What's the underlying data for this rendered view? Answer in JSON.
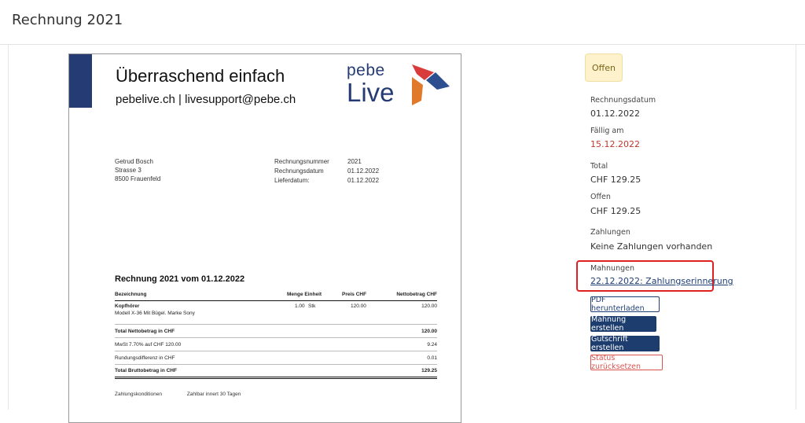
{
  "header": {
    "title": "Rechnung 2021"
  },
  "document": {
    "tagline": "Überraschend einfach",
    "contact": "pebelive.ch | livesupport@pebe.ch",
    "logo": {
      "line1": "pebe",
      "line2": "Live",
      "colors": {
        "navy": "#243c73",
        "red": "#d93a3a",
        "orange": "#e07a2a",
        "blue": "#2d4f8f"
      }
    },
    "customer": {
      "name": "Getrud Bosch",
      "street": "Strasse 3",
      "city": "8500 Frauenfeld"
    },
    "meta": [
      {
        "label": "Rechnungsnummer",
        "value": "2021"
      },
      {
        "label": "Rechnungsdatum",
        "value": "01.12.2022"
      },
      {
        "label": "Lieferdatum:",
        "value": "01.12.2022"
      }
    ],
    "invoice_title": "Rechnung 2021 vom 01.12.2022",
    "table": {
      "headers": {
        "desc": "Bezeichnung",
        "qty": "Menge Einheit",
        "price": "Preis CHF",
        "net": "Nettobetrag CHF"
      },
      "item": {
        "name": "Kopfhörer",
        "detail": "Modell X-36 Mit Bügel. Marke Sony",
        "qty": "1.00",
        "unit": "Stk",
        "price": "120.00",
        "net": "120.00"
      },
      "totals": [
        {
          "label": "Total Nettobetrag in CHF",
          "value": "120.00",
          "bold": true
        },
        {
          "label": "MwSt 7.70% auf CHF 120.00",
          "value": "9.24",
          "bold": false
        },
        {
          "label": "Rundungsdifferenz in CHF",
          "value": "0.01",
          "bold": false
        },
        {
          "label": "Total Bruttobetrag in CHF",
          "value": "129.25",
          "bold": true
        }
      ]
    },
    "terms": {
      "label": "Zahlungskonditionen",
      "value": "Zahlbar innert 30 Tagen"
    }
  },
  "panel": {
    "status": "Offen",
    "invoice_date_label": "Rechnungsdatum",
    "invoice_date": "01.12.2022",
    "due_label": "Fällig am",
    "due_date": "15.12.2022",
    "total_label": "Total",
    "total": "CHF 129.25",
    "open_label": "Offen",
    "open": "CHF 129.25",
    "payments_label": "Zahlungen",
    "payments": "Keine Zahlungen vorhanden",
    "reminders_label": "Mahnungen",
    "reminder_link": "22.12.2022: Zahlungserinnerung",
    "buttons": {
      "pdf": "PDF herunterladen",
      "reminder": "Mahnung erstellen",
      "credit": "Gutschrift erstellen",
      "reset": "Status zurücksetzen"
    }
  }
}
